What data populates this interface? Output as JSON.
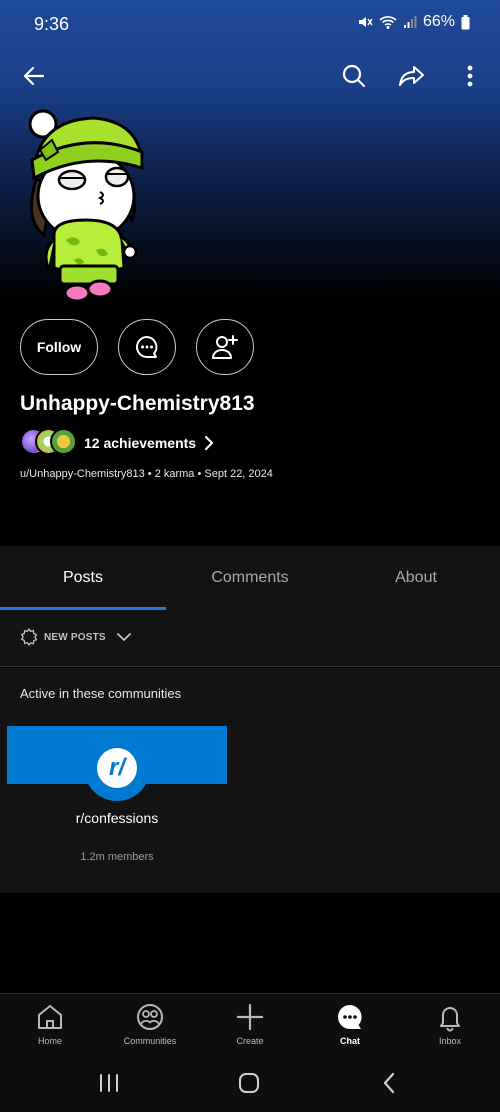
{
  "status_bar": {
    "time": "9:36",
    "battery": "66%"
  },
  "icons": {
    "back": "back-arrow-icon",
    "search": "search-icon",
    "share": "share-icon",
    "more": "more-vertical-icon"
  },
  "profile": {
    "follow_label": "Follow",
    "username": "Unhappy-Chemistry813",
    "achievements_label": "12 achievements",
    "meta": "u/Unhappy-Chemistry813 • 2 karma • Sept 22, 2024"
  },
  "tabs": [
    {
      "label": "Posts",
      "active": true
    },
    {
      "label": "Comments",
      "active": false
    },
    {
      "label": "About",
      "active": false
    }
  ],
  "sort": {
    "label": "NEW POSTS"
  },
  "communities": {
    "title": "Active in these communities",
    "items": [
      {
        "logo_text": "r/",
        "name": "r/confessions",
        "members": "1.2m members"
      }
    ]
  },
  "bottom_nav": [
    {
      "label": "Home",
      "icon": "home-icon",
      "active": false
    },
    {
      "label": "Communities",
      "icon": "communities-icon",
      "active": false
    },
    {
      "label": "Create",
      "icon": "plus-icon",
      "active": false
    },
    {
      "label": "Chat",
      "icon": "chat-icon",
      "active": true
    },
    {
      "label": "Inbox",
      "icon": "bell-icon",
      "active": false
    }
  ],
  "colors": {
    "accent": "#1e7ad6",
    "community_brand": "#0079d3",
    "header_gradient_top": "#1f4a99"
  }
}
